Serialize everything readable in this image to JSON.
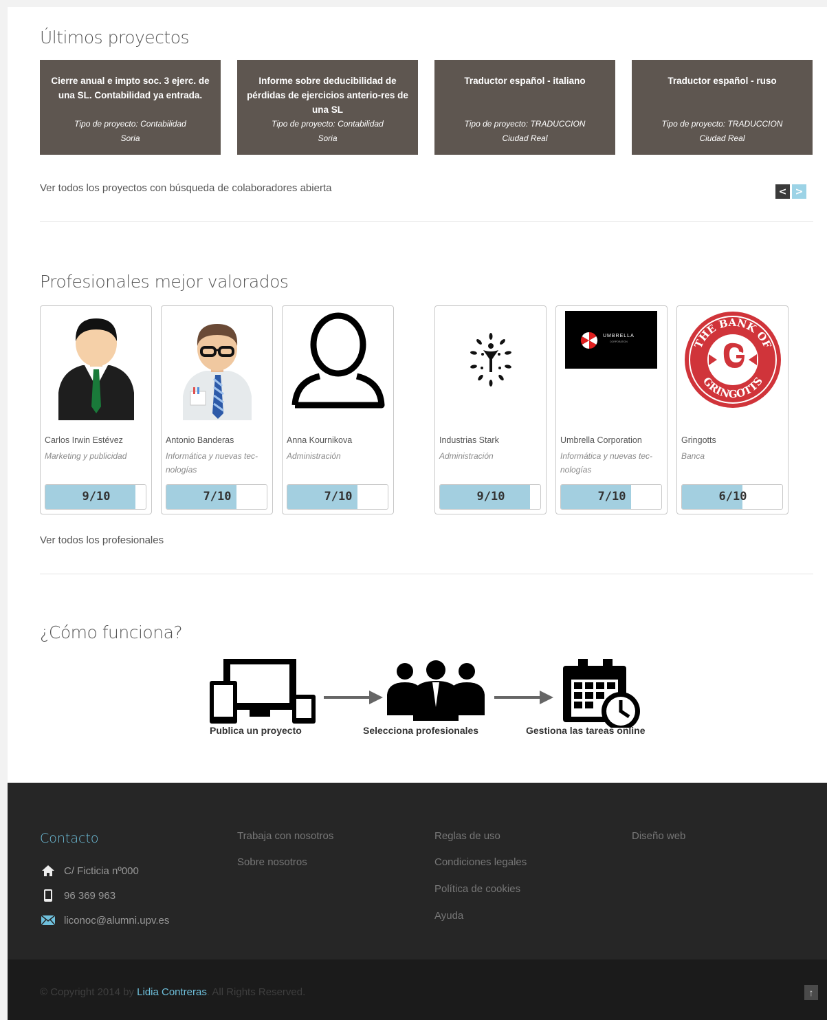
{
  "latest_projects": {
    "title": "Últimos proyectos",
    "items": [
      {
        "title": "Cierre anual e impto soc. 3 ejerc. de una SL. Contabilidad ya entrada.",
        "type": "Tipo de proyecto: Contabilidad",
        "city": "Soria"
      },
      {
        "title": "Informe sobre deducibilidad de pérdidas de ejercicios anterio-res de una SL",
        "type": "Tipo de proyecto: Contabilidad",
        "city": "Soria"
      },
      {
        "title": "Traductor español - italiano",
        "type": "Tipo de proyecto: TRADUCCION",
        "city": "Ciudad Real"
      },
      {
        "title": "Traductor español - ruso",
        "type": "Tipo de proyecto: TRADUCCION",
        "city": "Ciudad Real"
      }
    ],
    "see_all_link": "Ver todos los proyectos con búsqueda de colaboradores abierta",
    "prev_label": "<",
    "next_label": ">"
  },
  "top_professionals": {
    "title": "Profesionales mejor valorados",
    "items": [
      {
        "name": "Carlos Irwin Estévez",
        "category": "Marketing y publicidad",
        "score_label": "9/10",
        "score": 9,
        "max": 10,
        "avatar": "businessman-avatar-icon"
      },
      {
        "name": "Antonio Banderas",
        "category": "Informática y nuevas tec-nologías",
        "score_label": "7/10",
        "score": 7,
        "max": 10,
        "avatar": "glasses-man-avatar-icon"
      },
      {
        "name": "Anna Kournikova",
        "category": "Administración",
        "score_label": "7/10",
        "score": 7,
        "max": 10,
        "avatar": "user-outline-icon"
      },
      {
        "name": "Industrias Stark",
        "category": "Administración",
        "score_label": "9/10",
        "score": 9,
        "max": 10,
        "avatar": "stark-tree-logo"
      },
      {
        "name": "Umbrella Corporation",
        "category": "Informática y nuevas tec-nologías",
        "score_label": "7/10",
        "score": 7,
        "max": 10,
        "avatar": "umbrella-corporation-logo"
      },
      {
        "name": "Gringotts",
        "category": "Banca",
        "score_label": "6/10",
        "score": 6,
        "max": 10,
        "avatar": "gringotts-seal-logo"
      }
    ],
    "see_all_link": "Ver todos los profesionales",
    "logo_text": {
      "umbrella": "UMBRELLA",
      "umbrella_sub": "CORPORATION",
      "gringotts_top": "THE BANK OF",
      "gringotts_bottom": "GRINGOTTS"
    }
  },
  "how_it_works": {
    "title": "¿Cómo funciona?",
    "steps": [
      {
        "label": "Publica un proyecto",
        "icon": "devices-icon"
      },
      {
        "label": "Selecciona profesionales",
        "icon": "team-icon"
      },
      {
        "label": "Gestiona las tareas online",
        "icon": "calendar-clock-icon"
      }
    ]
  },
  "footer": {
    "contact_title": "Contacto",
    "address": "C/ Ficticia nº000",
    "phone": "96 369 963",
    "email": "liconoc@alumni.upv.es",
    "col2": [
      "Trabaja con nosotros",
      "Sobre nosotros"
    ],
    "col3": [
      "Reglas de uso",
      "Condiciones legales",
      "Política de cookies",
      "Ayuda"
    ],
    "col4": [
      "Diseño web"
    ],
    "copyright_pre": "© Copyright 2014 by ",
    "author": "Lidia Contreras",
    "copyright_post": ". All Rights Reserved.",
    "to_top": "↑"
  },
  "colors": {
    "project_card": "#5e5650",
    "rating_fill": "#a3cfe0",
    "accent": "#6fc0dc",
    "footer_bg": "#262626"
  }
}
